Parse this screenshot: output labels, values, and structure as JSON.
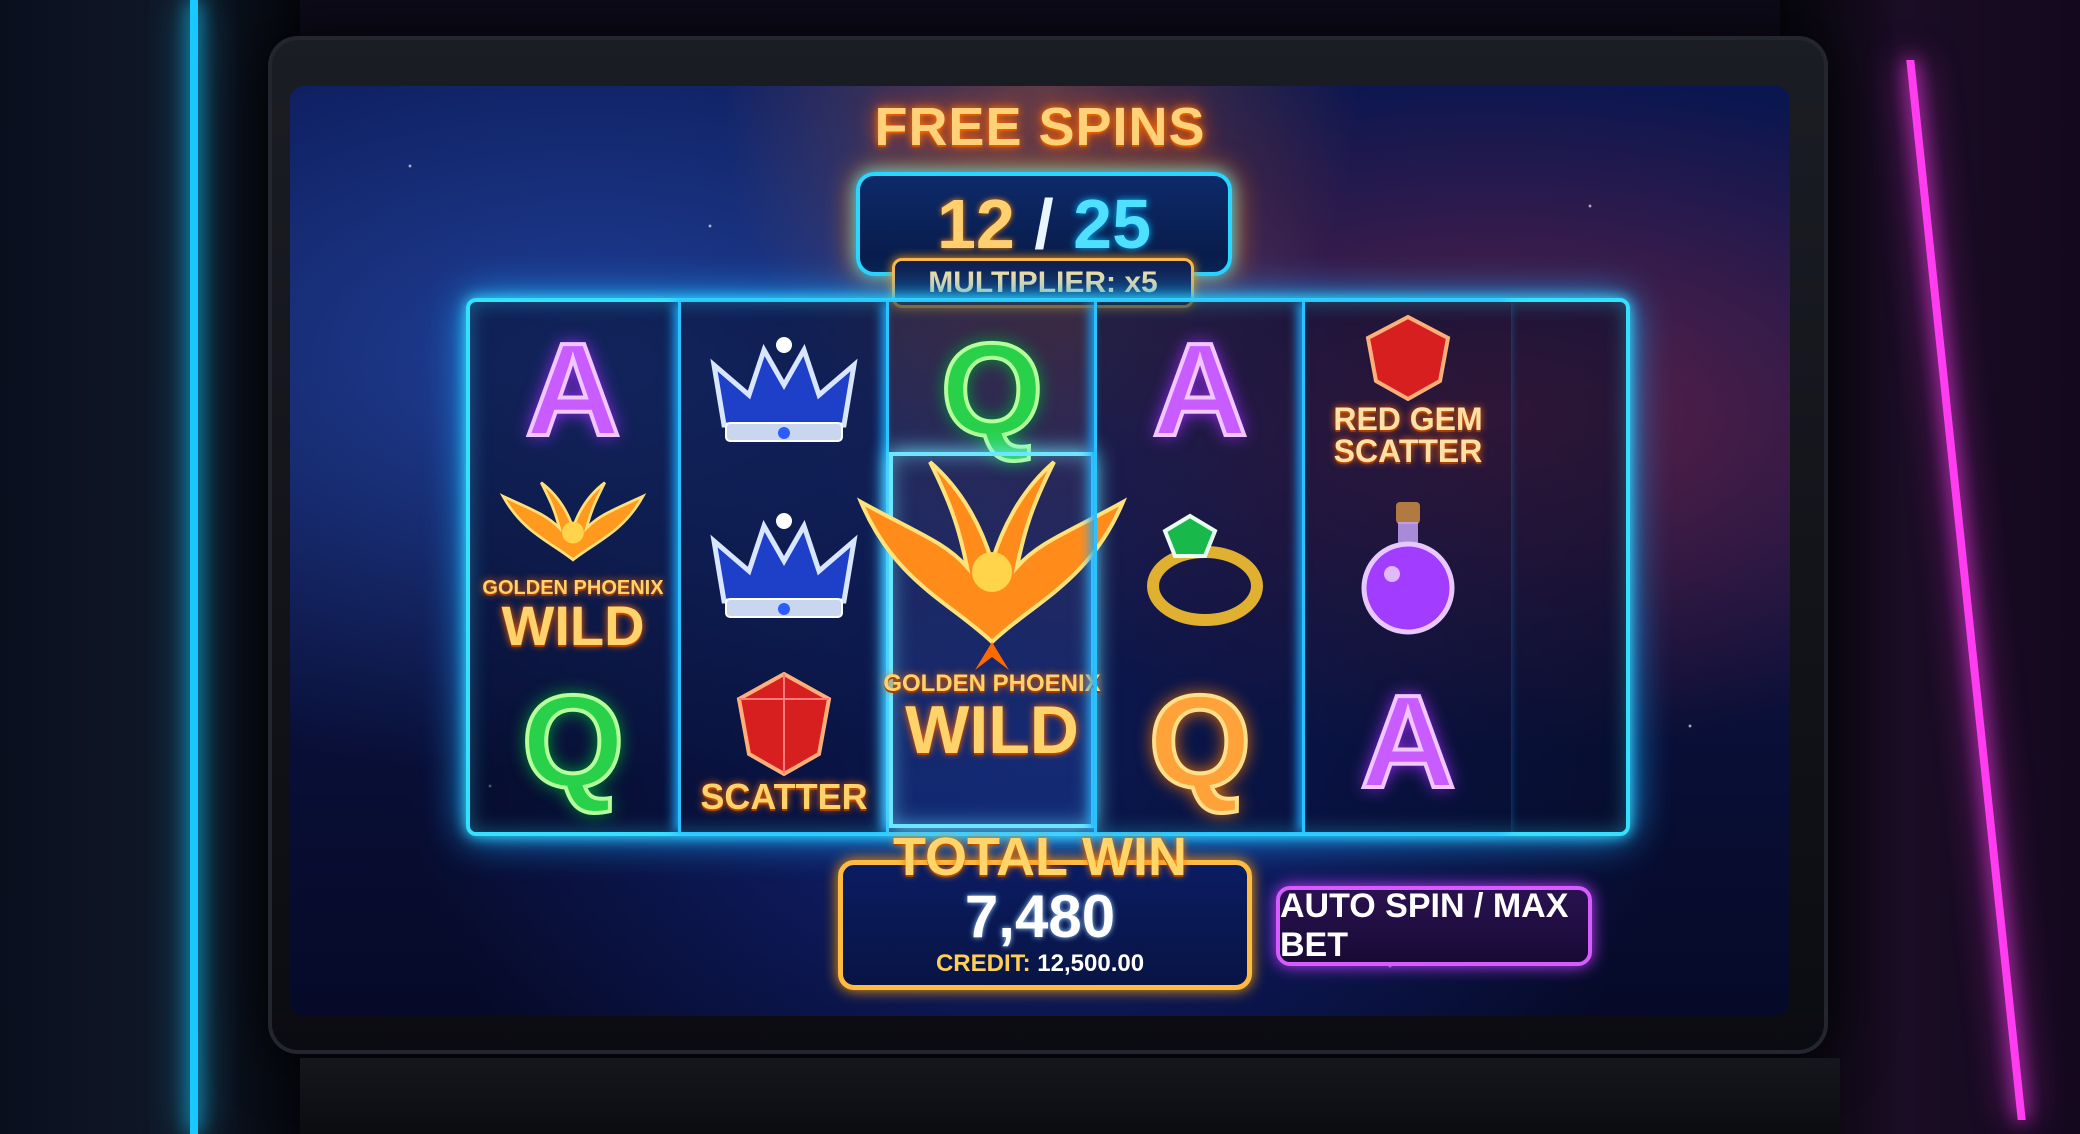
{
  "header": {
    "title": "FREE SPINS",
    "spins_done": "12",
    "separator": "/",
    "spins_total": "25",
    "multiplier": "MULTIPLIER: x5"
  },
  "reels": {
    "r1": {
      "top": "A",
      "wild_sub": "GOLDEN PHOENIX",
      "wild_main": "WILD",
      "bottom": "Q"
    },
    "r2": {
      "top_icon": "crown-icon",
      "mid_icon": "crown-icon",
      "scatter": "SCATTER"
    },
    "r3": {
      "top": "Q",
      "wild_sub": "GOLDEN PHOENIX",
      "wild_main": "WILD"
    },
    "r4": {
      "top": "A",
      "mid_icon": "emerald-ring-icon",
      "bottom": "Q"
    },
    "r5": {
      "gem_line1": "RED GEM",
      "gem_line2": "SCATTER",
      "mid_icon": "potion-icon",
      "bottom": "A"
    }
  },
  "win": {
    "title": "TOTAL WIN",
    "value": "7,480",
    "credit_label": "CREDIT:",
    "credit_value": "12,500.00"
  },
  "controls": {
    "auto_spin": "AUTO SPIN / MAX BET"
  },
  "colors": {
    "neon_cyan": "#36e0ff",
    "neon_magenta": "#d65cff",
    "gold": "#ffba40"
  }
}
